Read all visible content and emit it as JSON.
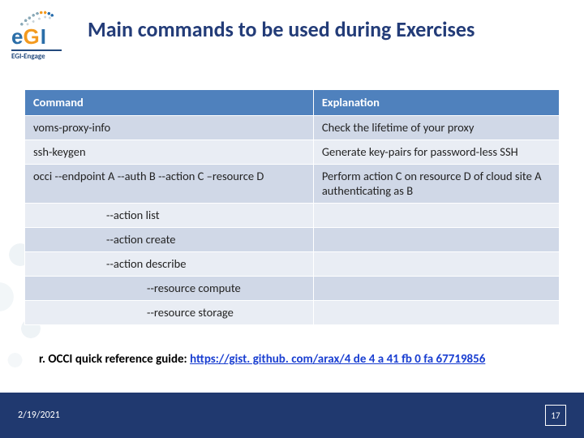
{
  "logo": {
    "wordmark_e": "e",
    "wordmark_g": "G",
    "wordmark_i": "I",
    "subbrand": "EGI-Engage"
  },
  "title": "Main commands to be used during Exercises",
  "table": {
    "headers": {
      "command": "Command",
      "explanation": "Explanation"
    },
    "rows": [
      {
        "command": "voms-proxy-info",
        "explanation": "Check the lifetime of your proxy",
        "indent": 0
      },
      {
        "command": "ssh-keygen",
        "explanation": "Generate key-pairs for password-less SSH",
        "indent": 0
      },
      {
        "command": "occi --endpoint A --auth B --action C –resource D",
        "explanation": "Perform action C on resource D of cloud site A authenticating as B",
        "indent": 0
      },
      {
        "command": "--action list",
        "explanation": "",
        "indent": 1
      },
      {
        "command": "--action create",
        "explanation": "",
        "indent": 1
      },
      {
        "command": "--action describe",
        "explanation": "",
        "indent": 1
      },
      {
        "command": "--resource compute",
        "explanation": "",
        "indent": 2
      },
      {
        "command": "--resource storage",
        "explanation": "",
        "indent": 2
      }
    ]
  },
  "reference": {
    "label": "r. OCCI quick reference guide: ",
    "url_text": "https://gist. github. com/arax/4 de 4 a 41 fb 0 fa 67719856"
  },
  "footer": {
    "date": "2/19/2021",
    "page": "17"
  }
}
